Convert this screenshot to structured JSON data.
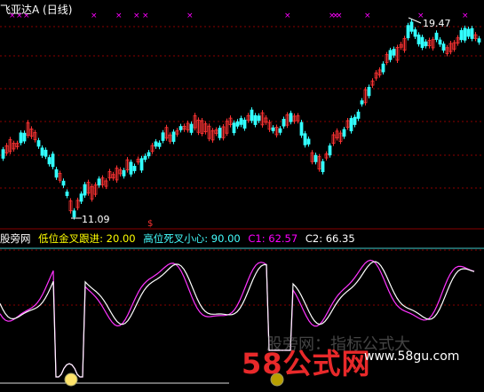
{
  "title": "飞亚达A (日线)",
  "price_panel": {
    "high_label": "19.47",
    "low_label": "11.09",
    "signal": "$"
  },
  "indicator": {
    "name": "股旁网",
    "low_cross": "低位金叉跟进: 20.00",
    "high_cross": "高位死叉小心: 90.00",
    "c1": "C1: 62.57",
    "c2": "C2: 66.35"
  },
  "watermark": {
    "text": "58公式网",
    "sub": "股旁网：指标公式大",
    "url": "www.58gu.com"
  },
  "colors": {
    "up": "#ff3333",
    "down": "#33ffff",
    "k": "#ffffff",
    "d": "#ff33ff",
    "grid": "#8b0000"
  }
}
